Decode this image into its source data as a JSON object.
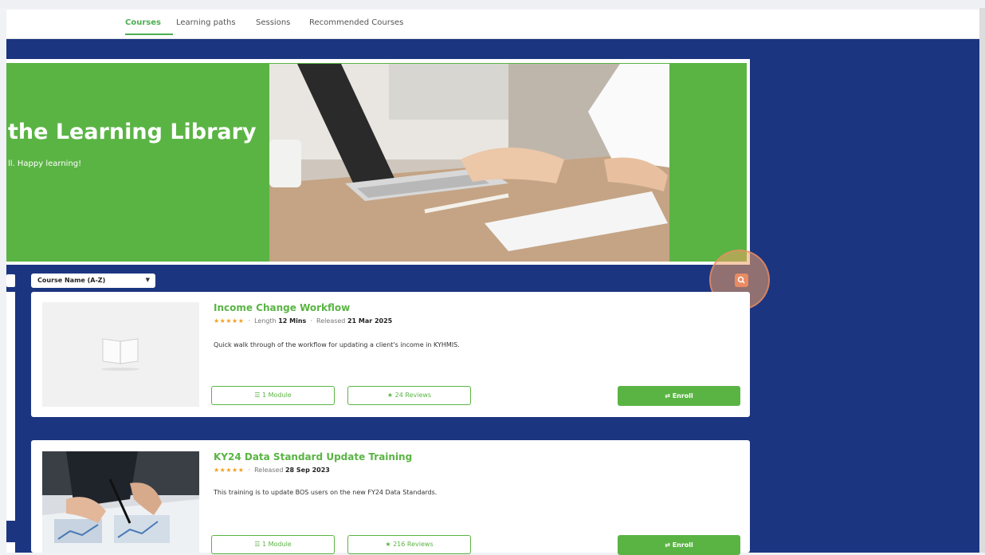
{
  "tabs": [
    {
      "label": "Courses",
      "active": true
    },
    {
      "label": "Learning paths",
      "active": false
    },
    {
      "label": "Sessions",
      "active": false
    },
    {
      "label": "Recommended Courses",
      "active": false
    }
  ],
  "hero": {
    "title": "the Learning Library",
    "subtitle": "ll. Happy learning!"
  },
  "filters": {
    "sort_label": "Course Name (A-Z)",
    "sort_caret": "▼",
    "search_icon": "search-icon"
  },
  "courses": [
    {
      "title": "Income Change Workflow",
      "stars": "★★★★★",
      "sep": "·",
      "length_label": "Length",
      "length_value": "12 Mins",
      "released_label": "Released",
      "released_value": "21 Mar 2025",
      "description": "Quick walk through of the workflow for updating a client's income in KYHMIS.",
      "modules": "1 Module",
      "reviews": "24 Reviews",
      "enroll": "Enroll"
    },
    {
      "title": "KY24 Data Standard Update Training",
      "stars": "★★★★★",
      "sep": "·",
      "released_label": "Released",
      "released_value": "28 Sep 2023",
      "description": "This training is to update BOS users on the new FY24 Data Standards.",
      "modules": "1 Module",
      "reviews": "216 Reviews",
      "enroll": "Enroll"
    }
  ],
  "colors": {
    "brand_green": "#5ab444",
    "navy": "#1b3580",
    "accent_orange": "#e88b63"
  }
}
